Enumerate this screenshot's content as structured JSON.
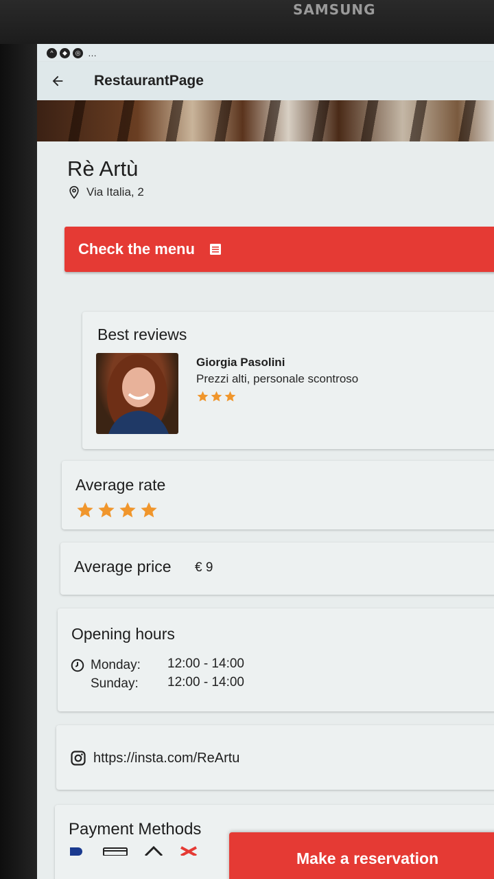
{
  "device": {
    "brand": "SAMSUNG"
  },
  "appbar": {
    "title": "RestaurantPage"
  },
  "restaurant": {
    "name": "Rè Artù",
    "address": "Via Italia, 2"
  },
  "menu_button": {
    "label": "Check the menu"
  },
  "best_reviews": {
    "title": "Best reviews",
    "review": {
      "author": "Giorgia Pasolini",
      "text": "Prezzi alti, personale scontroso",
      "stars": 3
    }
  },
  "average_rate": {
    "title": "Average rate",
    "stars": 4
  },
  "average_price": {
    "title": "Average price",
    "value": "€ 9"
  },
  "opening_hours": {
    "title": "Opening hours",
    "rows": [
      {
        "day": "Monday:",
        "hours": "12:00 - 14:00"
      },
      {
        "day": "Sunday:",
        "hours": "12:00 - 14:00"
      }
    ]
  },
  "instagram": {
    "url": "https://insta.com/ReArtu"
  },
  "payment": {
    "title": "Payment Methods"
  },
  "reserve_button": {
    "label": "Make a reservation"
  },
  "colors": {
    "accent": "#e53a34",
    "star": "#f0962c"
  },
  "icons": [
    "arrow-back-icon",
    "location-icon",
    "menu-list-icon",
    "star-icon",
    "clock-icon",
    "instagram-icon"
  ]
}
